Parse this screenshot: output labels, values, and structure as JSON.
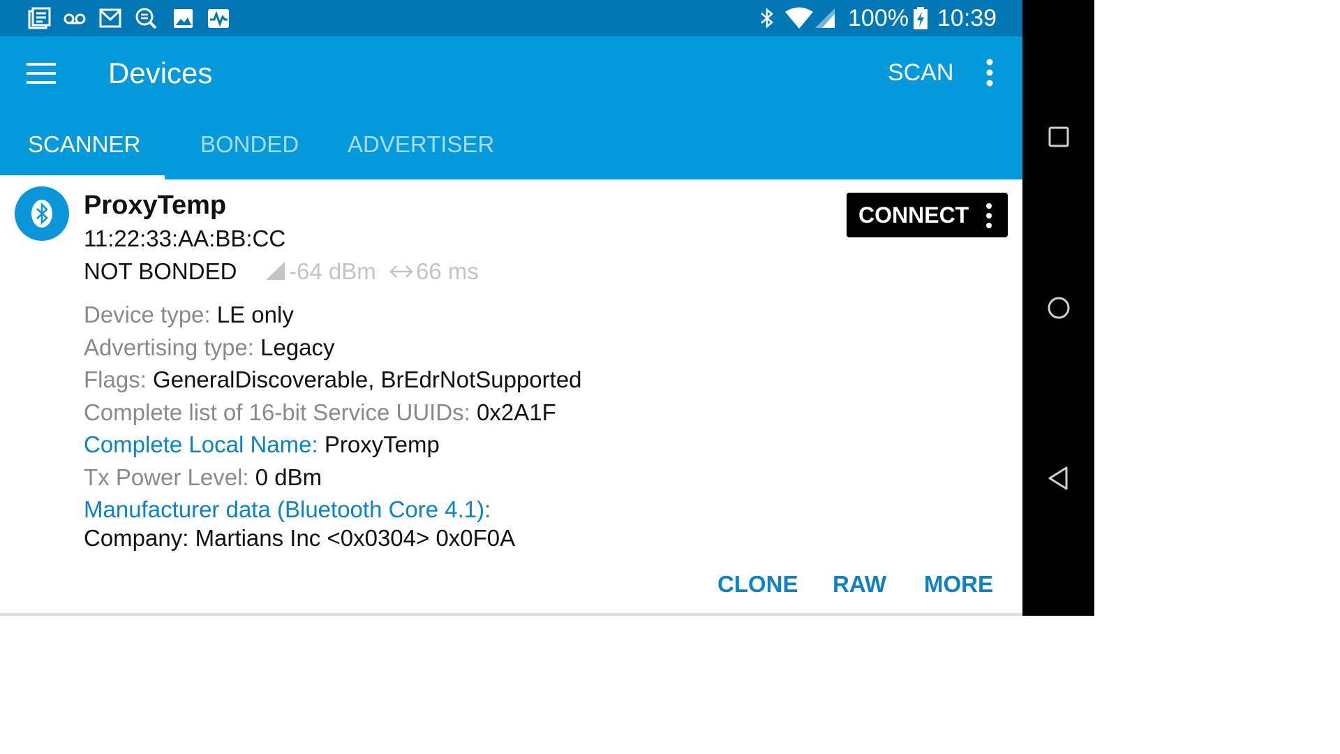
{
  "status_bar": {
    "icons": [
      "news-icon",
      "voicemail-icon",
      "gmail-icon",
      "search-doc-icon",
      "image-icon",
      "activity-icon"
    ],
    "right_icons": [
      "bluetooth-icon",
      "wifi-icon",
      "cell-signal-icon",
      "battery-charging-icon"
    ],
    "battery": "100%",
    "time": "10:39",
    "color": "#0277b6"
  },
  "app_bar": {
    "title": "Devices",
    "scan_label": "SCAN",
    "color": "#0399db",
    "tabs": [
      {
        "label": "SCANNER",
        "active": true
      },
      {
        "label": "BONDED",
        "active": false
      },
      {
        "label": "ADVERTISER",
        "active": false
      }
    ]
  },
  "device": {
    "icon": "bluetooth-icon",
    "name": "ProxyTemp",
    "address": "11:22:33:AA:BB:CC",
    "bond_state": "NOT BONDED",
    "rssi": "-64 dBm",
    "interval": "66 ms",
    "connect_label": "CONNECT",
    "details": [
      {
        "label": "Device type: ",
        "value": "LE only"
      },
      {
        "label": "Advertising type: ",
        "value": "Legacy"
      },
      {
        "label": "Flags: ",
        "value": "GeneralDiscoverable, BrEdrNotSupported"
      },
      {
        "label": "Complete list of 16-bit Service UUIDs: ",
        "value": "0x2A1F"
      },
      {
        "label": "Complete Local Name: ",
        "value": "ProxyTemp"
      },
      {
        "label": "Tx Power Level: ",
        "value": "0 dBm"
      }
    ],
    "manufacturer_label": "Manufacturer data (Bluetooth Core 4.1):",
    "manufacturer_value": "Company: Martians Inc <0x0304> 0x0F0A",
    "actions": {
      "clone": "CLONE",
      "raw": "RAW",
      "more": "MORE"
    },
    "accent_color": "#0b83c4"
  },
  "nav_bar": {
    "buttons": [
      "recents-icon",
      "home-icon",
      "back-icon"
    ]
  }
}
